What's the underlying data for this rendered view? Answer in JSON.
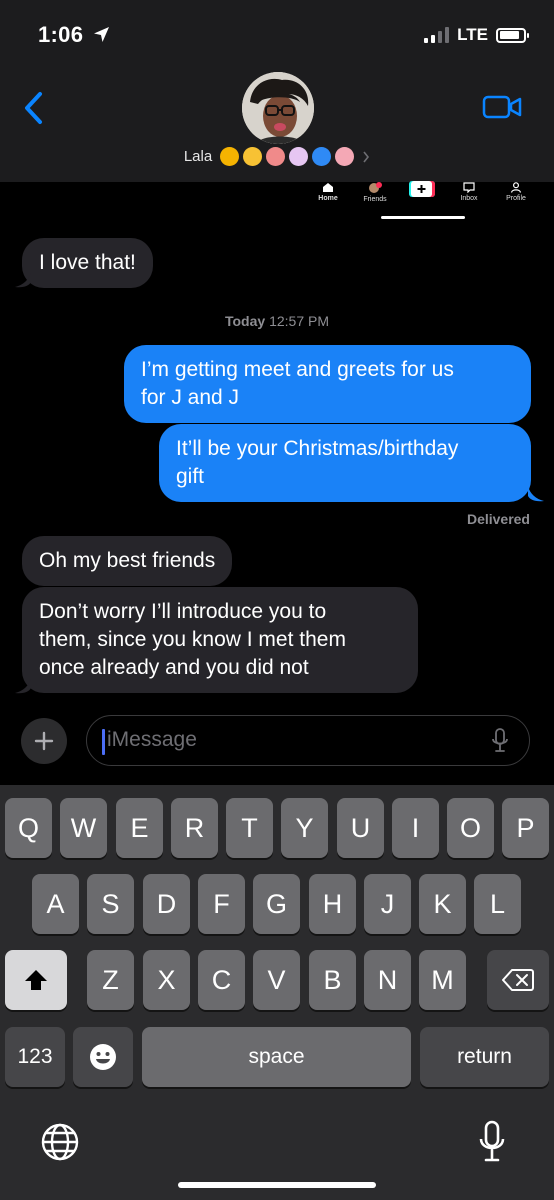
{
  "status_bar": {
    "time": "1:06",
    "network": "LTE",
    "battery_level": 0.85
  },
  "header": {
    "contact_name": "Lala",
    "emoji_colors": [
      "#f5b301",
      "#f7c234",
      "#f08a8a",
      "#e6c6f2",
      "#2f8af5",
      "#f4a8b5"
    ]
  },
  "overlay": {
    "nav_items": [
      "Home",
      "Friends",
      "Inbox",
      "Profile"
    ],
    "friends_badge": "1"
  },
  "messages": {
    "m1": "I love that!",
    "timestamp_day": "Today",
    "timestamp_time": "12:57 PM",
    "m2_line1": "I’m getting meet and greets for us",
    "m2_line2": "for J and J",
    "m3_line1": "It’ll be your Christmas/birthday",
    "m3_line2": "gift",
    "delivered": "Delivered",
    "m4": "Oh my best friends",
    "m5_line1": "Don’t worry I’ll introduce you to",
    "m5_line2": "them, since you know I met them",
    "m5_line3": "once already and you did not"
  },
  "input": {
    "placeholder": "iMessage"
  },
  "keyboard": {
    "row1": [
      "Q",
      "W",
      "E",
      "R",
      "T",
      "Y",
      "U",
      "I",
      "O",
      "P"
    ],
    "row2": [
      "A",
      "S",
      "D",
      "F",
      "G",
      "H",
      "J",
      "K",
      "L"
    ],
    "row3": [
      "Z",
      "X",
      "C",
      "V",
      "B",
      "N",
      "M"
    ],
    "numbers_label": "123",
    "space_label": "space",
    "return_label": "return"
  },
  "colors": {
    "outgoing": "#1a82f7",
    "incoming": "#26252a",
    "accent": "#0a84ff"
  }
}
